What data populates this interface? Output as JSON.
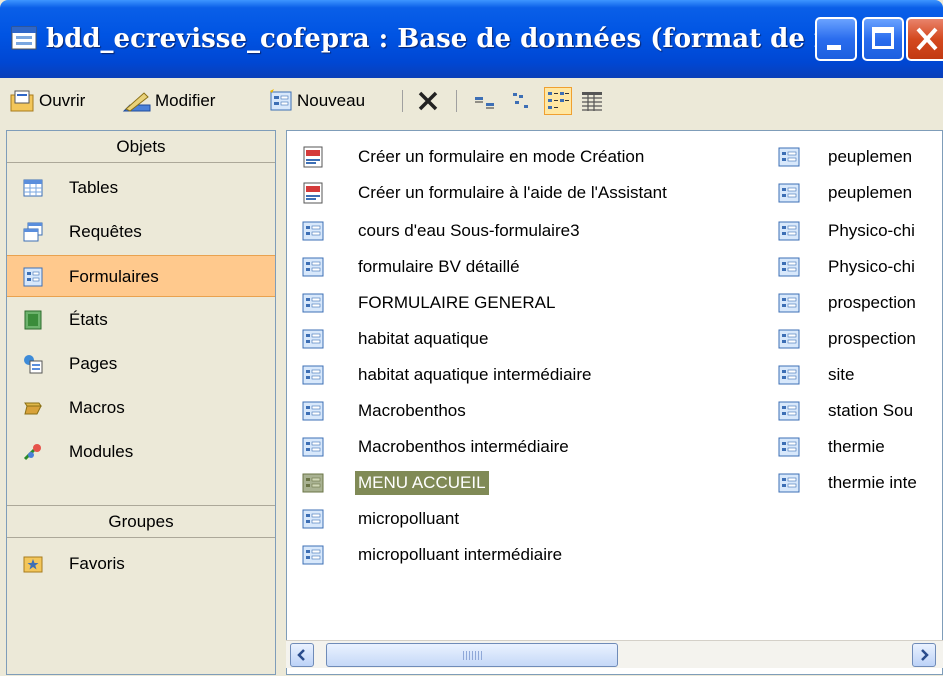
{
  "window": {
    "title": "bdd_ecrevisse_cofepra : Base de données (format de fichi..."
  },
  "toolbar": {
    "open_label": "Ouvrir",
    "modify_label": "Modifier",
    "new_label": "Nouveau"
  },
  "left_panel": {
    "objects_header": "Objets",
    "items": [
      {
        "label": "Tables",
        "icon": "table-icon"
      },
      {
        "label": "Requêtes",
        "icon": "query-icon"
      },
      {
        "label": "Formulaires",
        "icon": "form-icon"
      },
      {
        "label": "États",
        "icon": "report-icon"
      },
      {
        "label": "Pages",
        "icon": "page-icon"
      },
      {
        "label": "Macros",
        "icon": "macro-icon"
      },
      {
        "label": "Modules",
        "icon": "module-icon"
      }
    ],
    "selected": "Formulaires",
    "groups_header": "Groupes",
    "groups": [
      {
        "label": "Favoris",
        "icon": "favorites-icon"
      }
    ]
  },
  "forms_col1": [
    "Créer un formulaire en mode Création",
    "Créer un formulaire à l'aide de l'Assistant",
    "cours d'eau Sous-formulaire3",
    "formulaire BV détaillé",
    "FORMULAIRE GENERAL",
    "habitat aquatique",
    "habitat aquatique intermédiaire",
    "Macrobenthos",
    "Macrobenthos intermédiaire",
    "MENU ACCUEIL",
    "micropolluant",
    "micropolluant intermédiaire"
  ],
  "forms_col2": [
    "peuplemen",
    "peuplemen",
    "Physico-chi",
    "Physico-chi",
    "prospection",
    "prospection",
    "site",
    "station Sou",
    "thermie",
    "thermie inte"
  ],
  "selected_form": "MENU ACCUEIL",
  "colors": {
    "title_bar": "#0054e3",
    "selected_nav": "#ffc98d",
    "selected_item": "#808a56"
  }
}
